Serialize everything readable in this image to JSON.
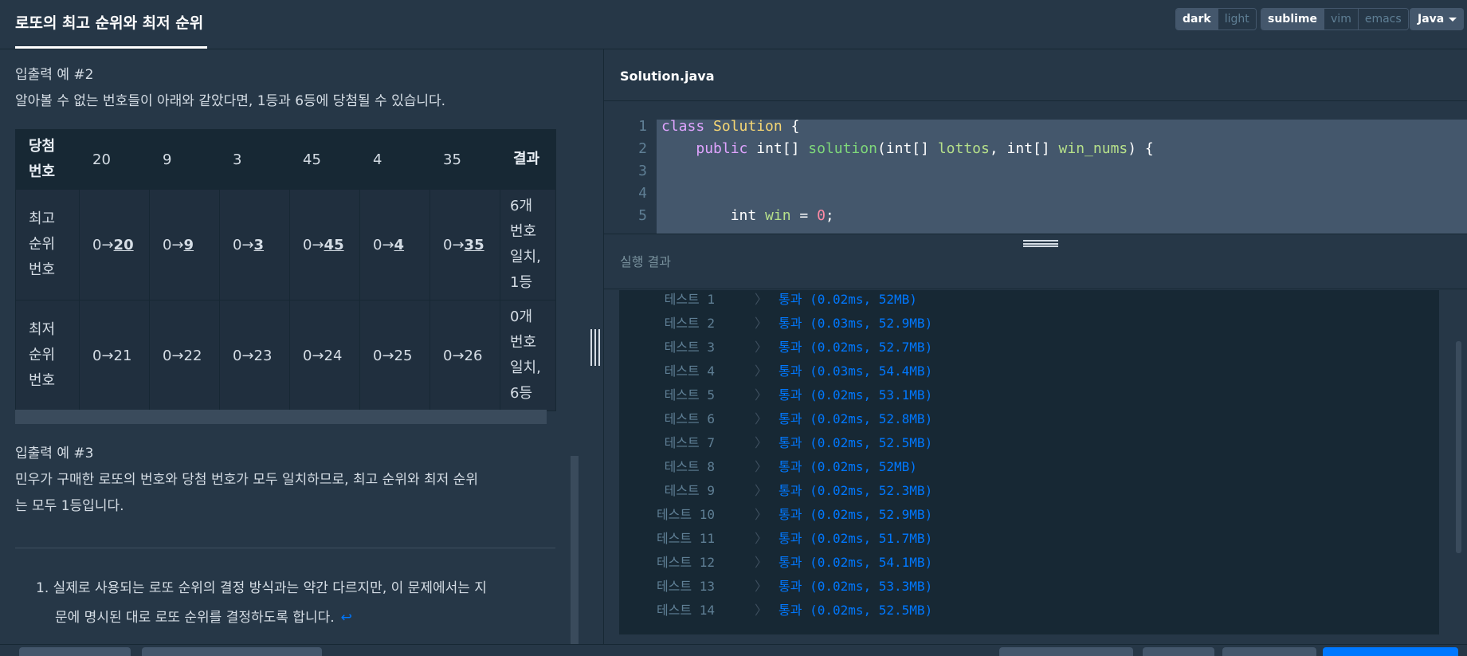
{
  "header": {
    "title": "로또의 최고 순위와 최저 순위",
    "theme": [
      "dark",
      "light"
    ],
    "theme_active": "dark",
    "keymap": [
      "sublime",
      "vim",
      "emacs"
    ],
    "keymap_active": "sublime",
    "language": "Java"
  },
  "problem": {
    "example2_heading": "입출력 예 #2",
    "example2_text": "알아볼 수 없는 번호들이 아래와 같았다면, 1등과 6등에 당첨될 수 있습니다.",
    "table": {
      "header": [
        "당첨\n번호",
        "20",
        "9",
        "3",
        "45",
        "4",
        "35",
        "결과"
      ],
      "rows": [
        {
          "label": "최고\n순위\n번호",
          "cells": [
            {
              "pre": "0→",
              "val": "20"
            },
            {
              "pre": "0→",
              "val": "9"
            },
            {
              "pre": "0→",
              "val": "3"
            },
            {
              "pre": "0→",
              "val": "45"
            },
            {
              "pre": "0→",
              "val": "4"
            },
            {
              "pre": "0→",
              "val": "35"
            }
          ],
          "result": "6개\n번호\n일치,\n1등"
        },
        {
          "label": "최저\n순위\n번호",
          "cells": [
            "0→21",
            "0→22",
            "0→23",
            "0→24",
            "0→25",
            "0→26"
          ],
          "result": "0개\n번호\n일치,\n6등"
        }
      ]
    },
    "example3_heading": "입출력 예 #3",
    "example3_text_1": "민우가 구매한 로또의 번호와 당첨 번호가 모두 일치하므로, 최고 순위와 최저 순위",
    "example3_text_2": "는 모두 1등입니다.",
    "footnote_num": "1.",
    "footnote_1": "실제로 사용되는 로또 순위의 결정 방식과는 약간 다르지만, 이 문제에서는 지",
    "footnote_2": "문에 명시된 대로 로또 순위를 결정하도록 합니다.",
    "footnote_backref": "↩"
  },
  "editor": {
    "filename": "Solution.java",
    "line_numbers": [
      "1",
      "2",
      "3",
      "4",
      "5"
    ]
  },
  "results": {
    "title": "실행 결과",
    "rows": [
      {
        "name": "테스트 1",
        "chev": "〉",
        "result": "통과 (0.02ms, 52MB)"
      },
      {
        "name": "테스트 2",
        "chev": "〉",
        "result": "통과 (0.03ms, 52.9MB)"
      },
      {
        "name": "테스트 3",
        "chev": "〉",
        "result": "통과 (0.02ms, 52.7MB)"
      },
      {
        "name": "테스트 4",
        "chev": "〉",
        "result": "통과 (0.03ms, 54.4MB)"
      },
      {
        "name": "테스트 5",
        "chev": "〉",
        "result": "통과 (0.02ms, 53.1MB)"
      },
      {
        "name": "테스트 6",
        "chev": "〉",
        "result": "통과 (0.02ms, 52.8MB)"
      },
      {
        "name": "테스트 7",
        "chev": "〉",
        "result": "통과 (0.02ms, 52.5MB)"
      },
      {
        "name": "테스트 8",
        "chev": "〉",
        "result": "통과 (0.02ms, 52MB)"
      },
      {
        "name": "테스트 9",
        "chev": "〉",
        "result": "통과 (0.02ms, 52.3MB)"
      },
      {
        "name": "테스트 10",
        "chev": "〉",
        "result": "통과 (0.02ms, 52.9MB)"
      },
      {
        "name": "테스트 11",
        "chev": "〉",
        "result": "통과 (0.02ms, 51.7MB)"
      },
      {
        "name": "테스트 12",
        "chev": "〉",
        "result": "통과 (0.02ms, 54.1MB)"
      },
      {
        "name": "테스트 13",
        "chev": "〉",
        "result": "통과 (0.02ms, 53.3MB)"
      },
      {
        "name": "테스트 14",
        "chev": "〉",
        "result": "통과 (0.02ms, 52.5MB)"
      }
    ]
  },
  "colors": {
    "background": "#263747",
    "dark_background": "#172834",
    "accent_blue": "#0078ff",
    "selection": "#44576c"
  }
}
